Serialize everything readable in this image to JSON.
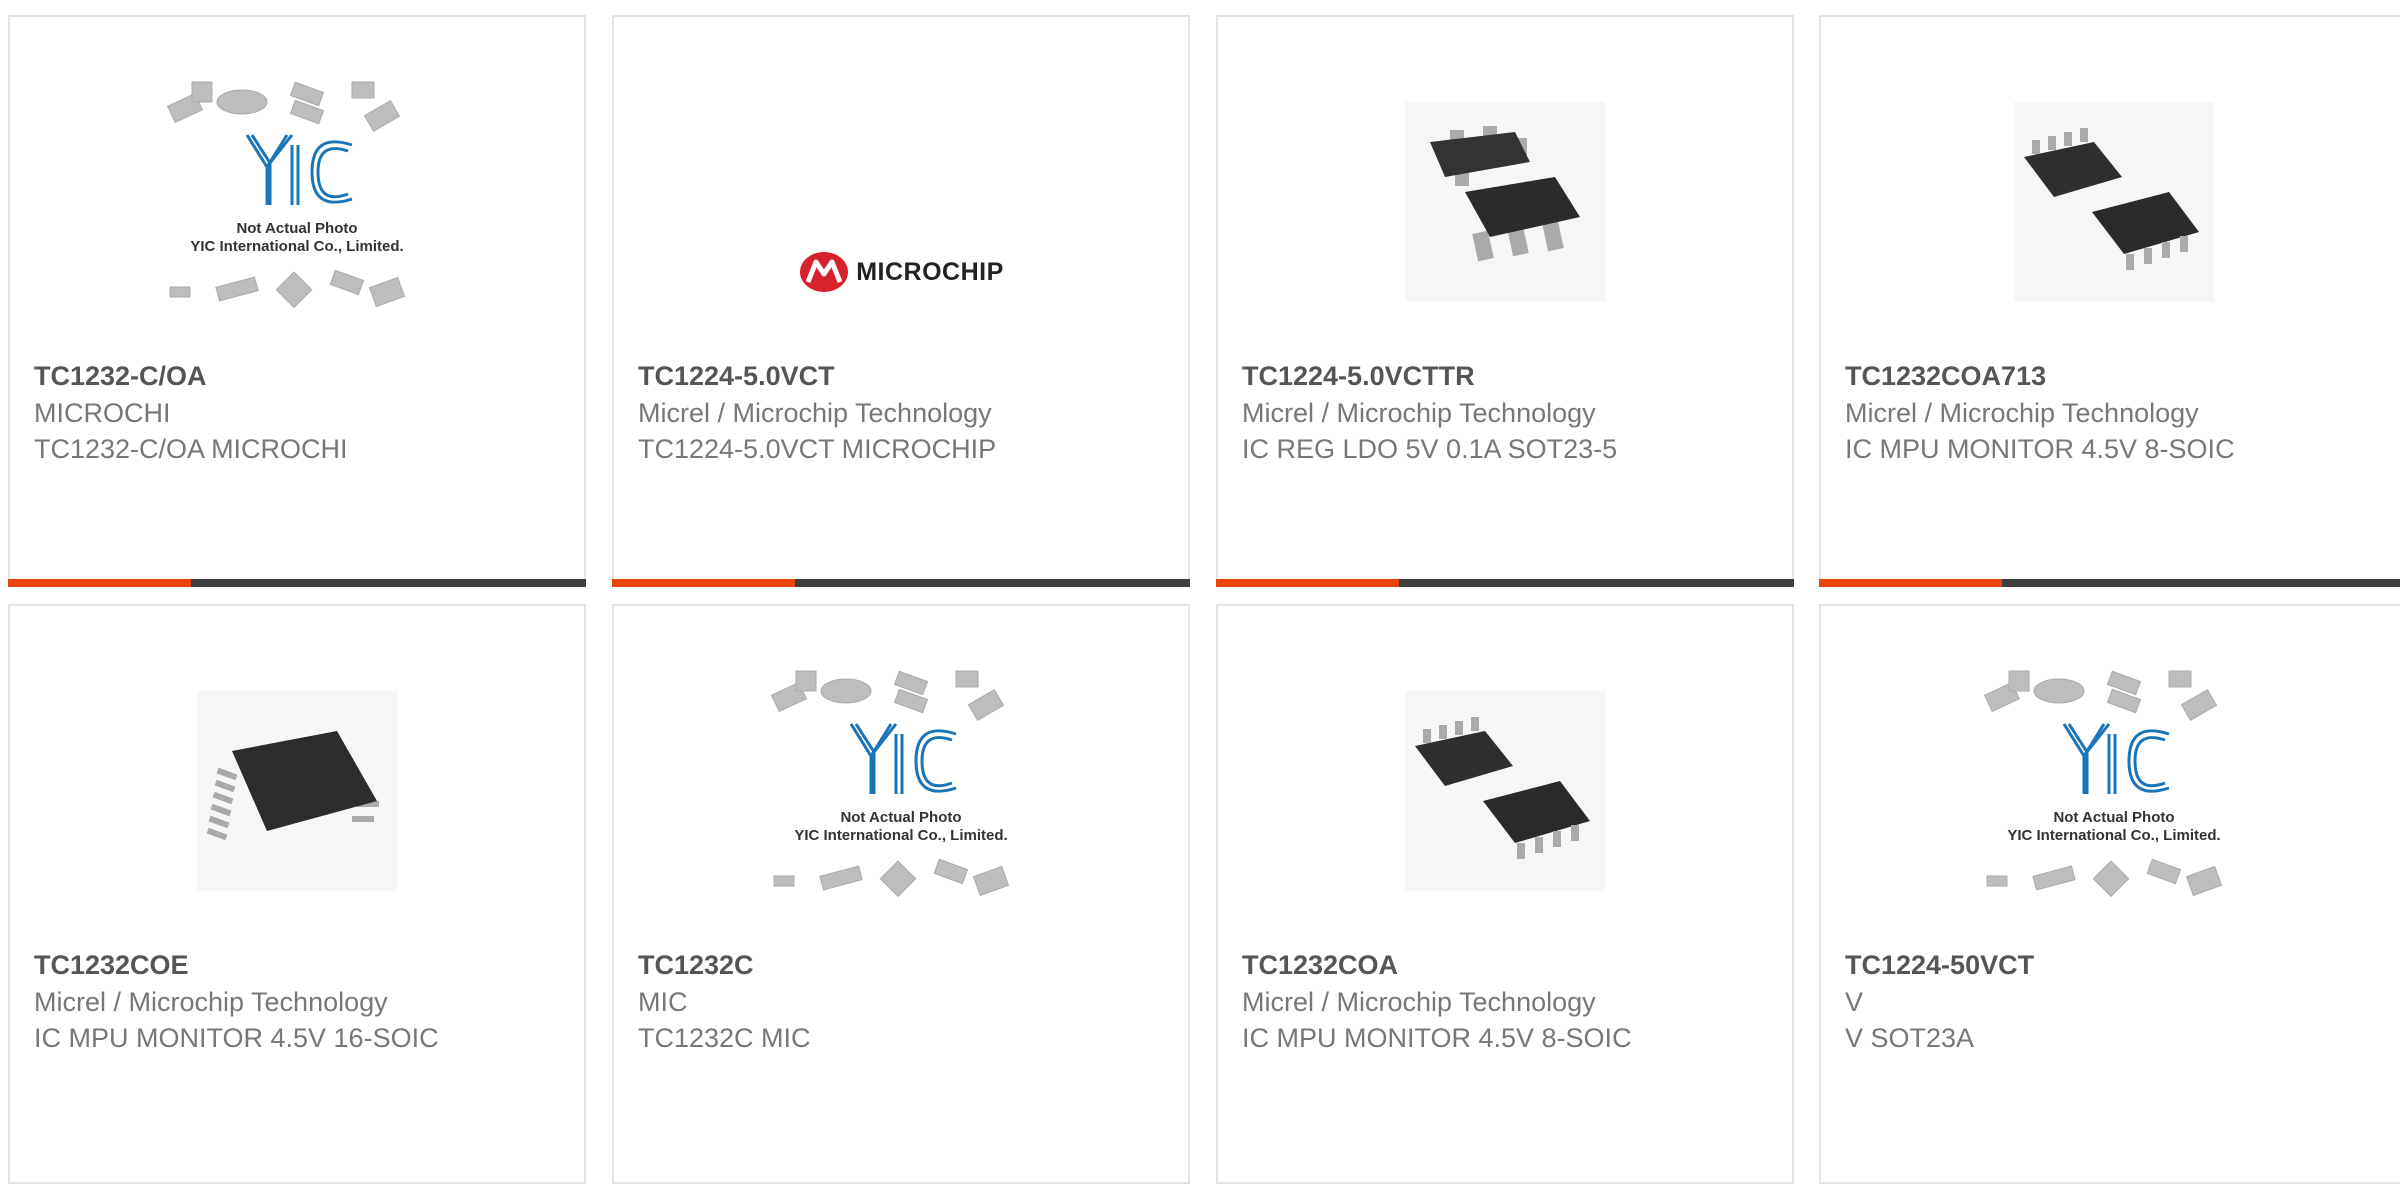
{
  "products": [
    {
      "part": "TC1232-C/OA",
      "manufacturer": "MICROCHI",
      "description": "TC1232-C/OA MICROCHI",
      "image": "yic-placeholder"
    },
    {
      "part": "TC1224-5.0VCT",
      "manufacturer": "Micrel / Microchip Technology",
      "description": "TC1224-5.0VCT MICROCHIP",
      "image": "microchip-logo"
    },
    {
      "part": "TC1224-5.0VCTTR",
      "manufacturer": "Micrel / Microchip Technology",
      "description": "IC REG LDO 5V 0.1A SOT23-5",
      "image": "sot23-photo"
    },
    {
      "part": "TC1232COA713",
      "manufacturer": "Micrel / Microchip Technology",
      "description": "IC MPU MONITOR 4.5V 8-SOIC",
      "image": "soic8-photo"
    },
    {
      "part": "TC1232COE",
      "manufacturer": "Micrel / Microchip Technology",
      "description": "IC MPU MONITOR 4.5V 16-SOIC",
      "image": "soic16-photo"
    },
    {
      "part": "TC1232C",
      "manufacturer": "MIC",
      "description": "TC1232C MIC",
      "image": "yic-placeholder"
    },
    {
      "part": "TC1232COA",
      "manufacturer": "Micrel / Microchip Technology",
      "description": "IC MPU MONITOR 4.5V 8-SOIC",
      "image": "soic8-photo"
    },
    {
      "part": "TC1224-50VCT",
      "manufacturer": "V",
      "description": "V SOT23A",
      "image": "yic-placeholder"
    }
  ],
  "placeholder": {
    "line1": "Not Actual Photo",
    "line2": "YIC International Co., Limited.",
    "logo": "YIC"
  },
  "brand_logo_text": "MICROCHIP",
  "colors": {
    "accent": "#e8450a",
    "bar": "#3f3f3f",
    "brand_red": "#d6222a",
    "yic_blue": "#1a74b8"
  }
}
